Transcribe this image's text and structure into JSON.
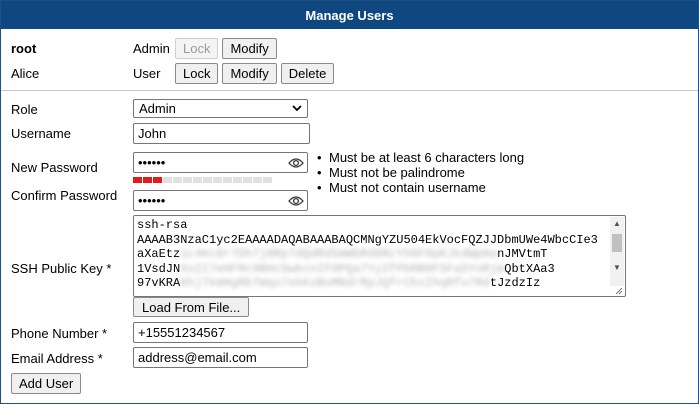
{
  "title": "Manage Users",
  "users": [
    {
      "name": "root",
      "role": "Admin",
      "lock_label": "Lock",
      "lock_disabled": true,
      "modify_label": "Modify"
    },
    {
      "name": "Alice",
      "role": "User",
      "lock_label": "Lock",
      "modify_label": "Modify",
      "delete_label": "Delete"
    }
  ],
  "form": {
    "role_label": "Role",
    "role_value": "Admin",
    "username_label": "Username",
    "username_value": "John",
    "new_password_label": "New Password",
    "new_password_value": "••••••",
    "password_strength": {
      "filled_segments": 3,
      "total_segments": 14
    },
    "confirm_password_label": "Confirm Password",
    "confirm_password_value": "••••••",
    "password_rules": [
      "Must be at least 6 characters long",
      "Must not be palindrome",
      "Must not contain username"
    ],
    "ssh_label": "SSH Public Key *",
    "ssh_lines": [
      "ssh-rsa",
      "AAAAB3NzaC1yc2EAAAADAQABAAABAQCMNgYZU504EkVocFQZJJDbmUWe4WbcCIe3",
      "aXaEtz",
      "1VsdJN",
      "97vKRA"
    ],
    "ssh_line_tails": [
      "",
      "",
      "nJMVtmT",
      "QbtXAa3",
      "tJzdzIz"
    ],
    "load_from_file_label": "Load From File...",
    "phone_label": "Phone Number *",
    "phone_value": "+15551234567",
    "email_label": "Email Address *",
    "email_value": "address@email.com",
    "add_user_label": "Add User"
  },
  "colors": {
    "header_bg": "#0f4880",
    "strength_on": "#e31b1b"
  }
}
